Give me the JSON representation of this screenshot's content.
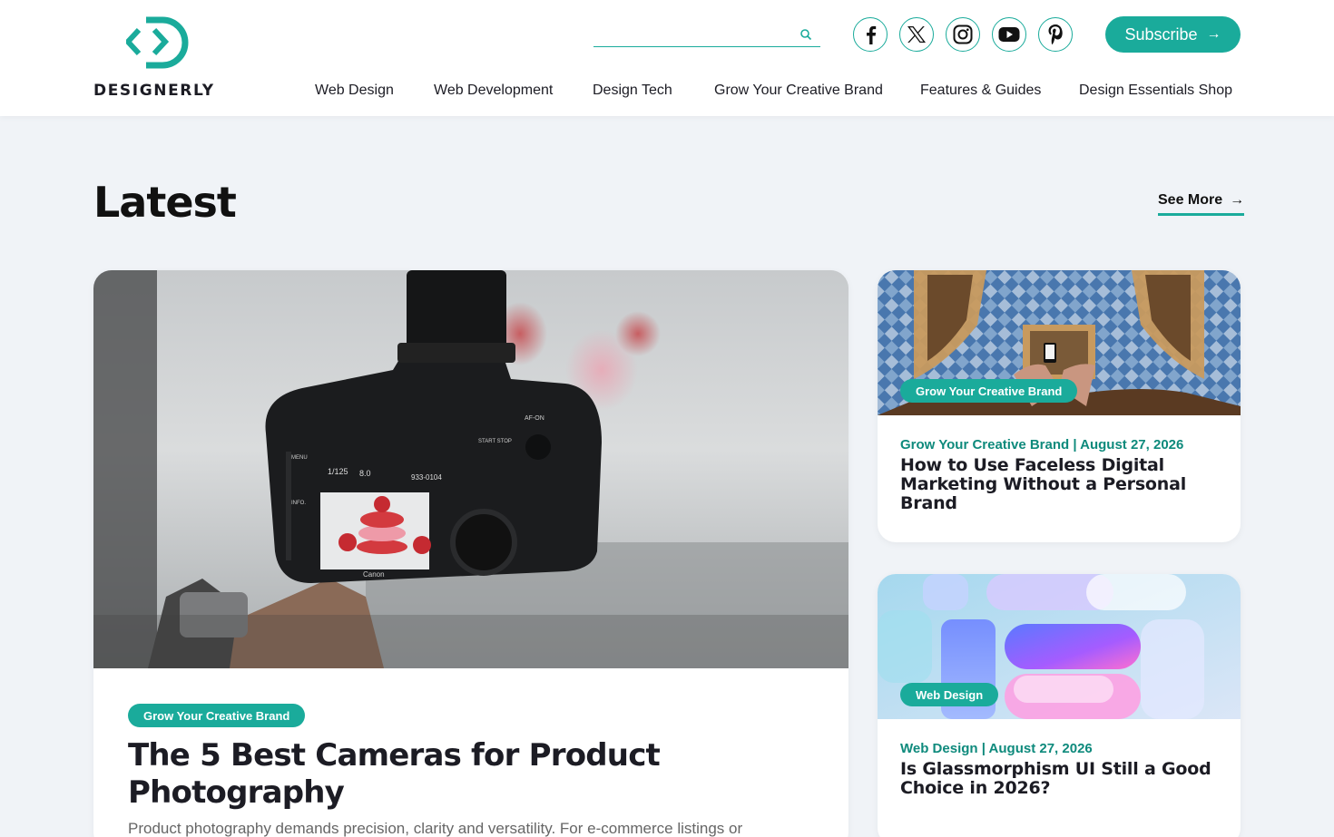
{
  "site": {
    "logo_text": "DESIGNERLY"
  },
  "search": {
    "placeholder": ""
  },
  "social": {
    "facebook": "facebook-icon",
    "x": "x-icon",
    "instagram": "instagram-icon",
    "youtube": "youtube-icon",
    "pinterest": "pinterest-icon"
  },
  "subscribe": {
    "label": "Subscribe",
    "arrow": "→"
  },
  "nav": {
    "items": [
      {
        "label": "Web Design"
      },
      {
        "label": "Web Development"
      },
      {
        "label": "Design Tech"
      },
      {
        "label": "Grow Your Creative Brand"
      },
      {
        "label": "Features & Guides"
      },
      {
        "label": "Design Essentials Shop"
      }
    ]
  },
  "section": {
    "title": "Latest",
    "see_more": "See More",
    "see_more_arrow": "→"
  },
  "featured": {
    "badge": "Grow Your Creative Brand",
    "title": "The 5 Best Cameras for Product Photography",
    "excerpt": "Product photography demands precision, clarity and versatility. For e-commerce listings or",
    "camera_text": {
      "shutter": "1/125",
      "aperture": "8.0",
      "code": "933-0104",
      "brand": "Canon",
      "af": "AF-ON",
      "start": "START STOP",
      "menu": "MENU",
      "info": "INFO."
    }
  },
  "side_posts": [
    {
      "badge": "Grow Your Creative Brand",
      "meta": "Grow Your Creative Brand | August 27, 2026",
      "title": "How to Use Faceless Digital Marketing Without a Personal Brand"
    },
    {
      "badge": "Web Design",
      "meta": "Web Design | August 27, 2026",
      "title": "Is Glassmorphism UI Still a Good Choice in 2026?"
    }
  ],
  "colors": {
    "accent": "#1aab9b",
    "meta_text": "#0e8a7c",
    "background": "#f0f3f7"
  }
}
